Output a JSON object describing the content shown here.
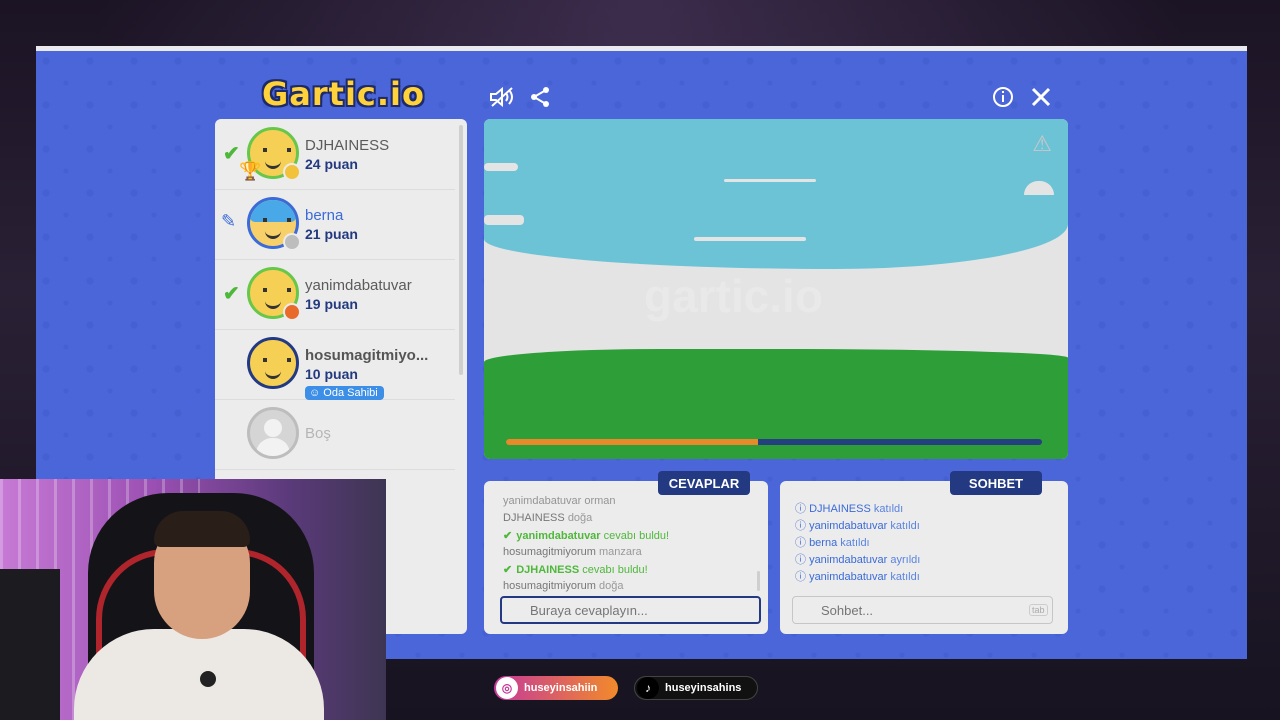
{
  "app": {
    "logo_text": "Gartic.io"
  },
  "toolbar": {
    "mute_icon": "speaker-mute-icon",
    "share_icon": "share-icon",
    "info_icon": "info-icon",
    "close_icon": "close-icon"
  },
  "players": [
    {
      "name": "DJHAINESS",
      "score": "24 puan",
      "marker": "check",
      "trophy": true,
      "status_color": "#f2c23a"
    },
    {
      "name": "berna",
      "score": "21 puan",
      "marker": "pencil",
      "status_color": "#bdbdbd"
    },
    {
      "name": "yanimdabatuvar",
      "score": "19 puan",
      "marker": "check",
      "status_color": "#e86b2b"
    },
    {
      "name": "hosumagitmiyo...",
      "score": "10 puan",
      "badge": "Oda Sahibi"
    },
    {
      "name": "Boş",
      "empty": true
    }
  ],
  "canvas": {
    "watermark": "gartic.io",
    "timer_progress": 0.47,
    "sky_color": "#6dc3d6",
    "grass_color": "#2e9e38",
    "timer_color": "#e98a2a"
  },
  "tabs": {
    "answers": "CEVAPLAR",
    "chat": "SOHBET"
  },
  "answers": [
    {
      "user": "yanimdabatuvar",
      "text": "orman"
    },
    {
      "user": "DJHAINESS",
      "text": "doğa"
    },
    {
      "user": "yanimdabatuvar",
      "text": "cevabı buldu!",
      "found": true
    },
    {
      "user": "hosumagitmiyorum",
      "text": "manzara"
    },
    {
      "user": "DJHAINESS",
      "text": "cevabı buldu!",
      "found": true
    },
    {
      "user": "hosumagitmiyorum",
      "text": "doğa"
    }
  ],
  "answer_input": {
    "placeholder": "Buraya cevaplayın..."
  },
  "chat": [
    {
      "user": "DJHAINESS",
      "text": "katıldı"
    },
    {
      "user": "yanimdabatuvar",
      "text": "katıldı"
    },
    {
      "user": "berna",
      "text": "katıldı"
    },
    {
      "user": "yanimdabatuvar",
      "text": "ayrıldı"
    },
    {
      "user": "yanimdabatuvar",
      "text": "katıldı"
    }
  ],
  "chat_input": {
    "placeholder": "Sohbet...",
    "key_hint": "tab"
  },
  "socials": {
    "instagram": "huseyinsahiin",
    "tiktok": "huseyinsahins"
  }
}
